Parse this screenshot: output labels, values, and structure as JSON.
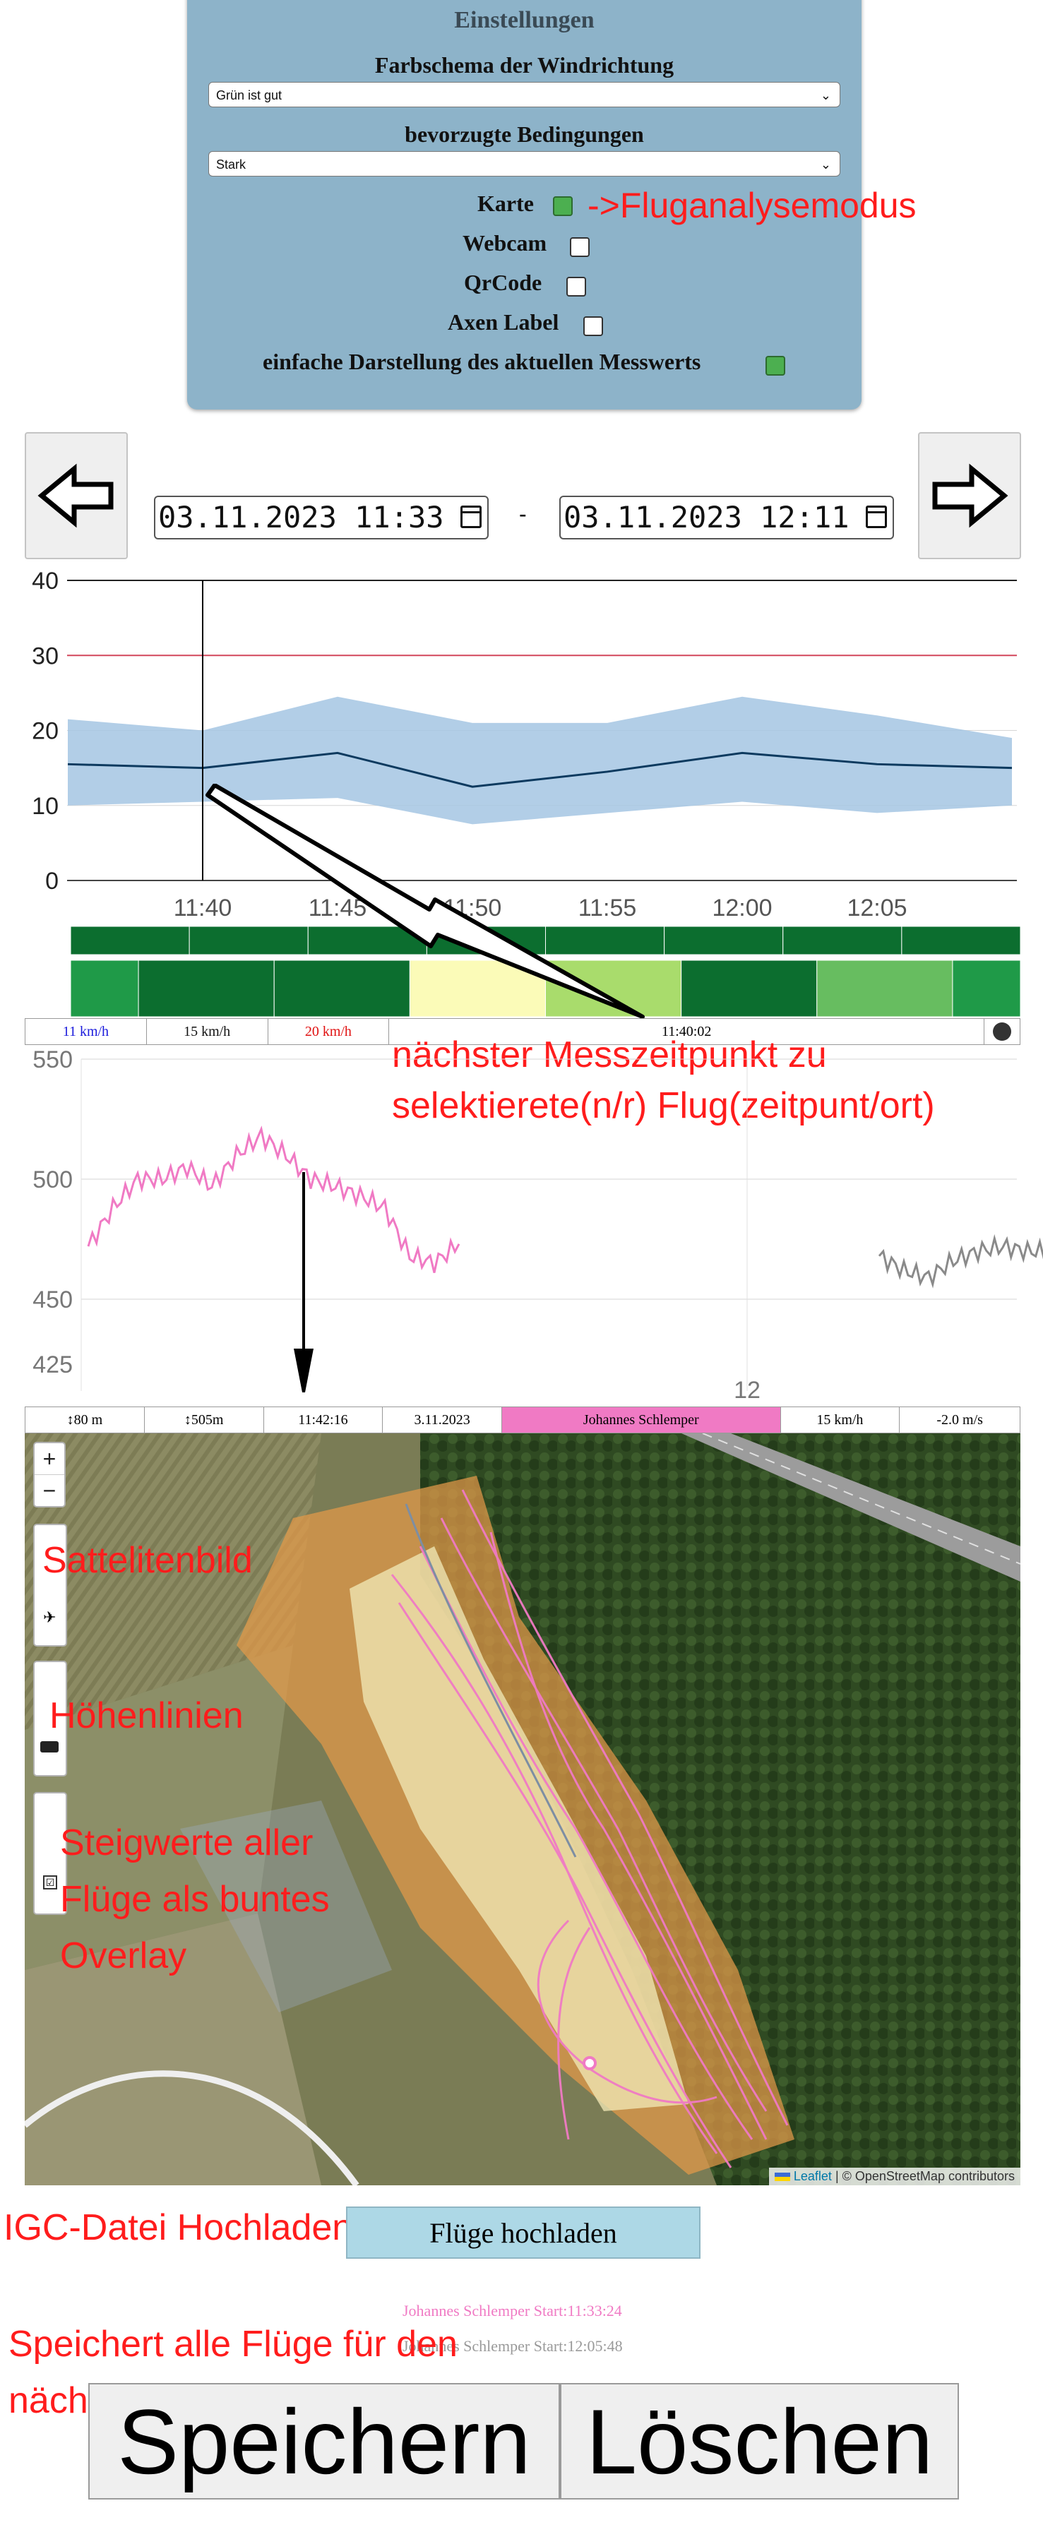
{
  "settings": {
    "title": "Einstellungen",
    "wind_color_label": "Farbschema der Windrichtung",
    "wind_color_value": "Grün ist gut",
    "conditions_label": "bevorzugte Bedingungen",
    "conditions_value": "Stark",
    "options": [
      {
        "label": "Karte",
        "checked": true
      },
      {
        "label": "Webcam",
        "checked": false
      },
      {
        "label": "QrCode",
        "checked": false
      },
      {
        "label": "Axen Label",
        "checked": false
      },
      {
        "label": "einfache Darstellung des aktuellen Messwerts",
        "checked": true
      }
    ]
  },
  "annotations": {
    "karte": "->Fluganalysemodus",
    "measurement_line1": "nächster Messzeitpunkt zu",
    "measurement_line2": "selektierete(n/r) Flug(zeitpunt/ort)",
    "satellite": "Sattelitenbild",
    "contours": "Höhenlinien",
    "climb_line1": "Steigwerte aller",
    "climb_line2": "Flüge als buntes",
    "climb_line3": "Overlay",
    "igc": "IGC-Datei Hochladen",
    "save_line1": "Speichert alle Flüge für den",
    "save_line2": "nächsten Besuch der App"
  },
  "nav": {
    "prev_icon": "arrow-left-icon",
    "next_icon": "arrow-right-icon",
    "date_from": "03.11.2023 11:33",
    "date_to": "03.11.2023 12:11",
    "separator": "-"
  },
  "wind_info": {
    "min": "11 km/h",
    "avg": "15 km/h",
    "max": "20 km/h",
    "time": "11:40:02",
    "colors": {
      "min": "#1a1adc",
      "avg": "#111111",
      "max": "#e01010"
    }
  },
  "flight_info": {
    "height_agl": "↕80 m",
    "height_msl": "↕505m",
    "time": "11:42:16",
    "date": "3.11.2023",
    "pilot": "Johannes Schlemper",
    "speed": "15 km/h",
    "vario": "-2.0 m/s",
    "pilot_color": "#f07ac4"
  },
  "map": {
    "zoom_in": "+",
    "zoom_out": "−",
    "attribution_leaflet": "Leaflet",
    "attribution_osm": "| © OpenStreetMap contributors"
  },
  "upload": {
    "button": "Flüge hochladen"
  },
  "flights": [
    {
      "label": "Johannes Schlemper Start:11:33:24",
      "color": "#f07ac4"
    },
    {
      "label": "Johannes Schlemper Start:12:05:48",
      "color": "#9a9a9a"
    }
  ],
  "actions": {
    "save": "Speichern",
    "delete": "Löschen"
  },
  "chart_data": [
    {
      "type": "line",
      "x": [
        "11:35",
        "11:40",
        "11:45",
        "11:50",
        "11:55",
        "12:00",
        "12:05",
        "12:10"
      ],
      "series": [
        {
          "values": [
            15.5,
            15,
            17,
            12.5,
            14.5,
            17,
            15.5,
            15
          ]
        },
        {
          "values": [
            21.5,
            20,
            24.5,
            21,
            21,
            24.5,
            22,
            19
          ]
        },
        {
          "values": [
            10,
            10.5,
            11,
            7.5,
            9,
            10.5,
            9,
            10
          ]
        }
      ],
      "threshold": 30,
      "xticks": [
        "11:40",
        "11:45",
        "11:50",
        "11:55",
        "12:00",
        "12:05"
      ],
      "yticks": [
        0,
        10,
        20,
        30,
        40
      ],
      "ylim": [
        0,
        40
      ],
      "selected_x": "11:40",
      "colors": {
        "avg": "#0d3a5f",
        "band": "#a5c6e3",
        "threshold": "#d2475a"
      }
    },
    {
      "type": "heatmap",
      "top_row": [
        "#0c6e2f",
        "#0c6e2f",
        "#0c6e2f",
        "#0c6e2f",
        "#0c6e2f",
        "#0c6e2f",
        "#0c6e2f",
        "#0c6e2f"
      ],
      "bottom_row": [
        "#1f9a48",
        "#0c6e2f",
        "#0c6e2f",
        "#fbfbb8",
        "#a9dc6c",
        "#0c6e2f",
        "#67bd60",
        "#1f9a48"
      ],
      "bottom_widths": [
        0.5,
        1,
        1,
        1,
        1,
        1,
        1,
        0.5
      ]
    },
    {
      "type": "line",
      "yticks": [
        425,
        450,
        500,
        550
      ],
      "xlabel_mark": "12",
      "series": [
        {
          "name": "Johannes Schlemper Start:11:33:24",
          "color": "#f07ac4",
          "points": [
            [
              0,
              472
            ],
            [
              0.05,
              488
            ],
            [
              0.1,
              500
            ],
            [
              0.15,
              500
            ],
            [
              0.2,
              505
            ],
            [
              0.25,
              497
            ],
            [
              0.3,
              510
            ],
            [
              0.35,
              518
            ],
            [
              0.4,
              510
            ],
            [
              0.45,
              500
            ],
            [
              0.5,
              497
            ],
            [
              0.55,
              493
            ],
            [
              0.6,
              488
            ],
            [
              0.65,
              468
            ],
            [
              0.7,
              465
            ],
            [
              0.75,
              473
            ]
          ]
        },
        {
          "name": "Johannes Schlemper Start:12:05:48",
          "color": "#8a8a8a",
          "points": [
            [
              1.6,
              468
            ],
            [
              1.65,
              462
            ],
            [
              1.7,
              459
            ],
            [
              1.75,
              466
            ],
            [
              1.8,
              470
            ],
            [
              1.85,
              472
            ],
            [
              1.9,
              470
            ],
            [
              1.95,
              470
            ]
          ]
        }
      ]
    }
  ]
}
